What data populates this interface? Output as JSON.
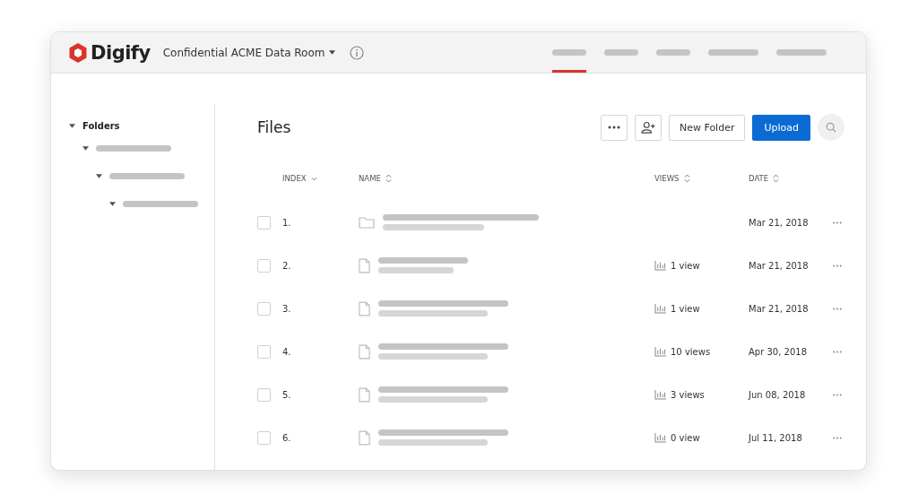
{
  "header": {
    "brand": "Digify",
    "room_title": "Confidential ACME Data Room",
    "nav_tabs": [
      {
        "selected": true
      },
      {
        "selected": false
      },
      {
        "selected": false
      },
      {
        "selected": false
      },
      {
        "selected": false
      }
    ]
  },
  "sidebar": {
    "title": "Folders",
    "expanded": true,
    "children": [
      {
        "expanded": true,
        "children": [
          {
            "expanded": true,
            "children": [
              {
                "expanded": true
              }
            ]
          }
        ]
      }
    ]
  },
  "main": {
    "title": "Files",
    "new_folder_button": "New Folder",
    "upload_button": "Upload",
    "table": {
      "columns": [
        {
          "label": "INDEX",
          "kind": "sorted"
        },
        {
          "label": "NAME",
          "kind": "sortable"
        },
        {
          "label": "VIEWS",
          "kind": "sortable"
        },
        {
          "label": "DATE",
          "kind": "sortable"
        }
      ],
      "rows": [
        {
          "checked": false,
          "index": "1.",
          "kind": "folder",
          "date": "Mar 21, 2018"
        },
        {
          "checked": false,
          "index": "2.",
          "kind": "file",
          "views": "1 view",
          "date": "Mar 21, 2018"
        },
        {
          "checked": false,
          "index": "3.",
          "kind": "file",
          "views": "1 view",
          "date": "Mar 21, 2018"
        },
        {
          "checked": false,
          "index": "4.",
          "kind": "file",
          "views": "10 views",
          "date": "Apr 30, 2018"
        },
        {
          "checked": false,
          "index": "5.",
          "kind": "file",
          "views": "3 views",
          "date": "Jun 08, 2018"
        },
        {
          "checked": false,
          "index": "6.",
          "kind": "file",
          "views": "0 view",
          "date": "Jul 11, 2018"
        }
      ]
    }
  }
}
